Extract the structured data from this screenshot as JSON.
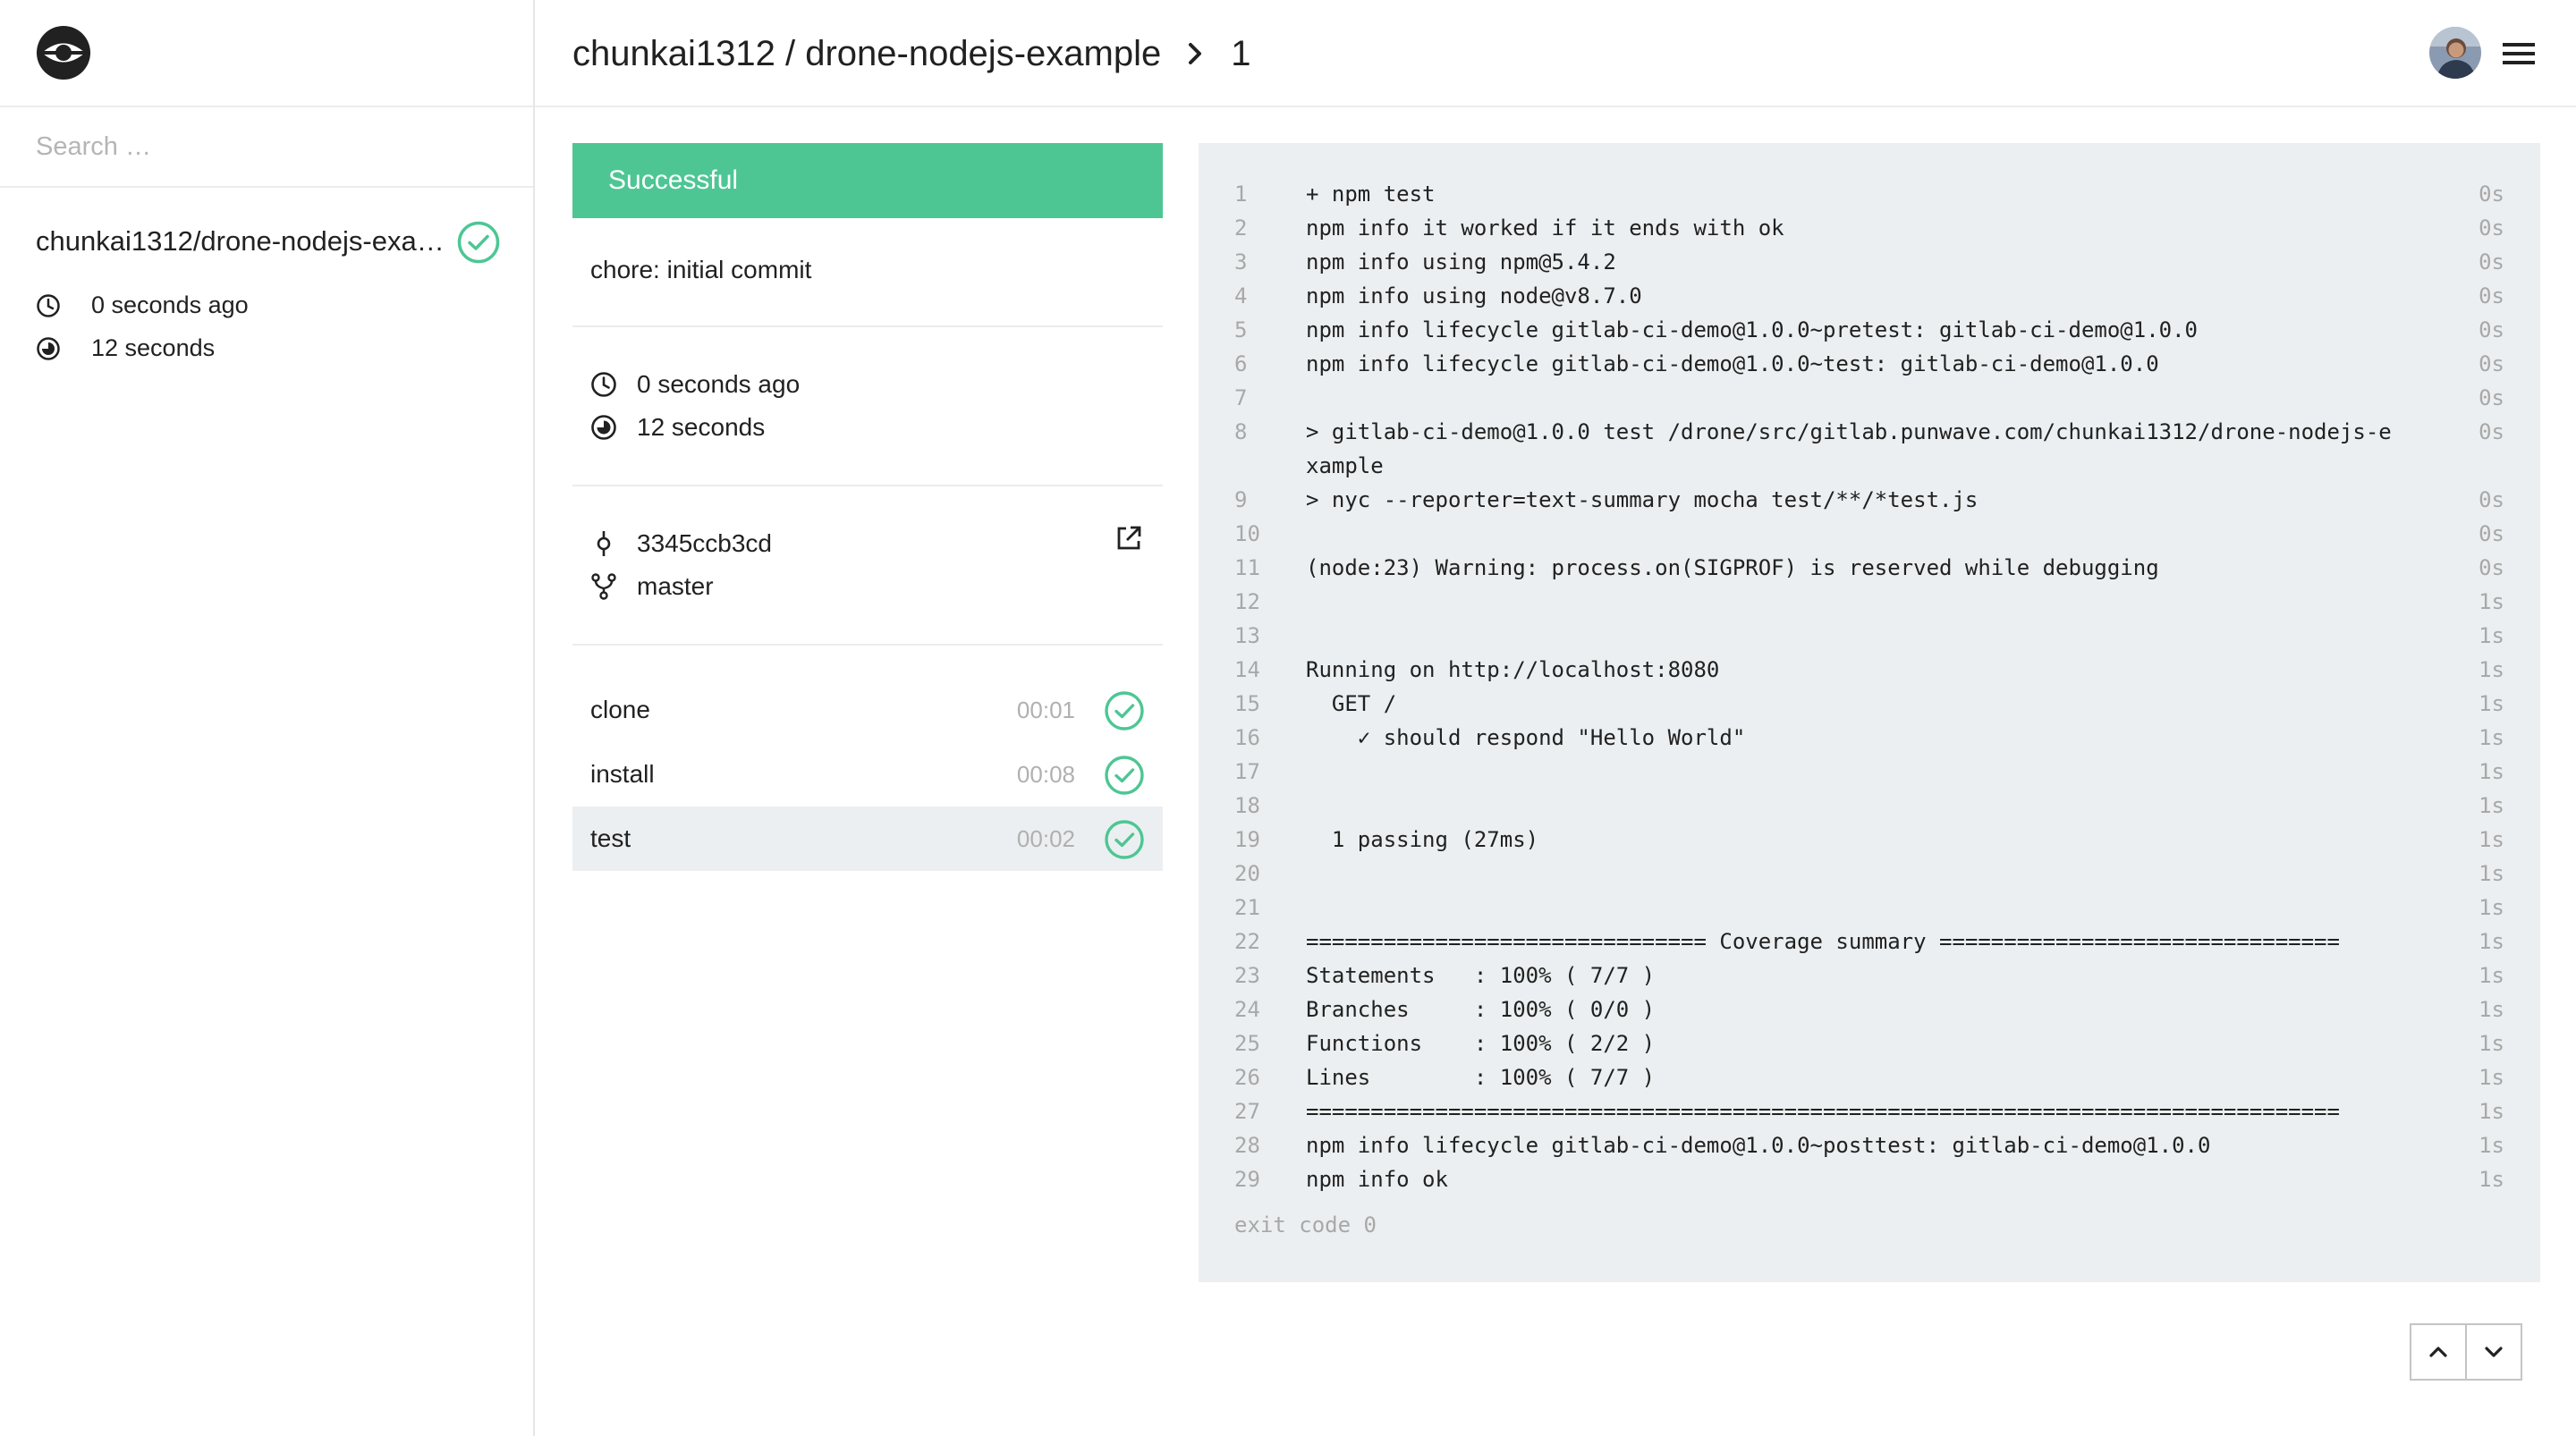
{
  "sidebar": {
    "search_placeholder": "Search …",
    "repo": {
      "name": "chunkai1312/drone-nodejs-exa…",
      "status_icon": "check-circle-icon",
      "created": "0 seconds ago",
      "duration": "12 seconds"
    }
  },
  "header": {
    "repo_path": "chunkai1312 / drone-nodejs-example",
    "build_number": "1"
  },
  "build": {
    "status": "Successful",
    "commit_message": "chore: initial commit",
    "created": "0 seconds ago",
    "duration": "12 seconds",
    "commit_sha": "3345ccb3cd",
    "branch": "master"
  },
  "steps": [
    {
      "name": "clone",
      "duration": "00:01",
      "status": "success"
    },
    {
      "name": "install",
      "duration": "00:08",
      "status": "success"
    },
    {
      "name": "test",
      "duration": "00:02",
      "status": "success",
      "active": true
    }
  ],
  "log": {
    "lines": [
      {
        "n": "1",
        "text": "+ npm test",
        "t": "0s"
      },
      {
        "n": "2",
        "text": "npm info it worked if it ends with ok",
        "t": "0s"
      },
      {
        "n": "3",
        "text": "npm info using npm@5.4.2",
        "t": "0s"
      },
      {
        "n": "4",
        "text": "npm info using node@v8.7.0",
        "t": "0s"
      },
      {
        "n": "5",
        "text": "npm info lifecycle gitlab-ci-demo@1.0.0~pretest: gitlab-ci-demo@1.0.0",
        "t": "0s"
      },
      {
        "n": "6",
        "text": "npm info lifecycle gitlab-ci-demo@1.0.0~test: gitlab-ci-demo@1.0.0",
        "t": "0s"
      },
      {
        "n": "7",
        "text": "",
        "t": "0s"
      },
      {
        "n": "8",
        "text": "> gitlab-ci-demo@1.0.0 test /drone/src/gitlab.punwave.com/chunkai1312/drone-nodejs-example",
        "t": "0s"
      },
      {
        "n": "9",
        "text": "> nyc --reporter=text-summary mocha test/**/*test.js",
        "t": "0s"
      },
      {
        "n": "10",
        "text": "",
        "t": "0s"
      },
      {
        "n": "11",
        "text": "(node:23) Warning: process.on(SIGPROF) is reserved while debugging",
        "t": "0s"
      },
      {
        "n": "12",
        "text": "",
        "t": "1s"
      },
      {
        "n": "13",
        "text": "",
        "t": "1s"
      },
      {
        "n": "14",
        "text": "Running on http://localhost:8080",
        "t": "1s"
      },
      {
        "n": "15",
        "text": "  GET /",
        "t": "1s"
      },
      {
        "n": "16",
        "text": "    ✓ should respond \"Hello World\"",
        "t": "1s"
      },
      {
        "n": "17",
        "text": "",
        "t": "1s"
      },
      {
        "n": "18",
        "text": "",
        "t": "1s"
      },
      {
        "n": "19",
        "text": "  1 passing (27ms)",
        "t": "1s"
      },
      {
        "n": "20",
        "text": "",
        "t": "1s"
      },
      {
        "n": "21",
        "text": "",
        "t": "1s"
      },
      {
        "n": "22",
        "text": "=============================== Coverage summary ===============================",
        "t": "1s"
      },
      {
        "n": "23",
        "text": "Statements   : 100% ( 7/7 )",
        "t": "1s"
      },
      {
        "n": "24",
        "text": "Branches     : 100% ( 0/0 )",
        "t": "1s"
      },
      {
        "n": "25",
        "text": "Functions    : 100% ( 2/2 )",
        "t": "1s"
      },
      {
        "n": "26",
        "text": "Lines        : 100% ( 7/7 )",
        "t": "1s"
      },
      {
        "n": "27",
        "text": "================================================================================",
        "t": "1s"
      },
      {
        "n": "28",
        "text": "npm info lifecycle gitlab-ci-demo@1.0.0~posttest: gitlab-ci-demo@1.0.0",
        "t": "1s"
      },
      {
        "n": "29",
        "text": "npm info ok",
        "t": "1s"
      }
    ],
    "exit_code": "exit code 0"
  },
  "colors": {
    "success": "#4dc694",
    "log_background": "#eceff1",
    "muted": "#a8a8a8"
  },
  "icons": {
    "logo": "drone-logo-icon",
    "clock": "clock-icon",
    "duration": "timelapse-icon",
    "commit": "commit-icon",
    "branch": "branch-icon",
    "external": "external-link-icon",
    "menu": "menu-icon",
    "scroll_up": "chevron-up-icon",
    "scroll_down": "chevron-down-icon"
  }
}
